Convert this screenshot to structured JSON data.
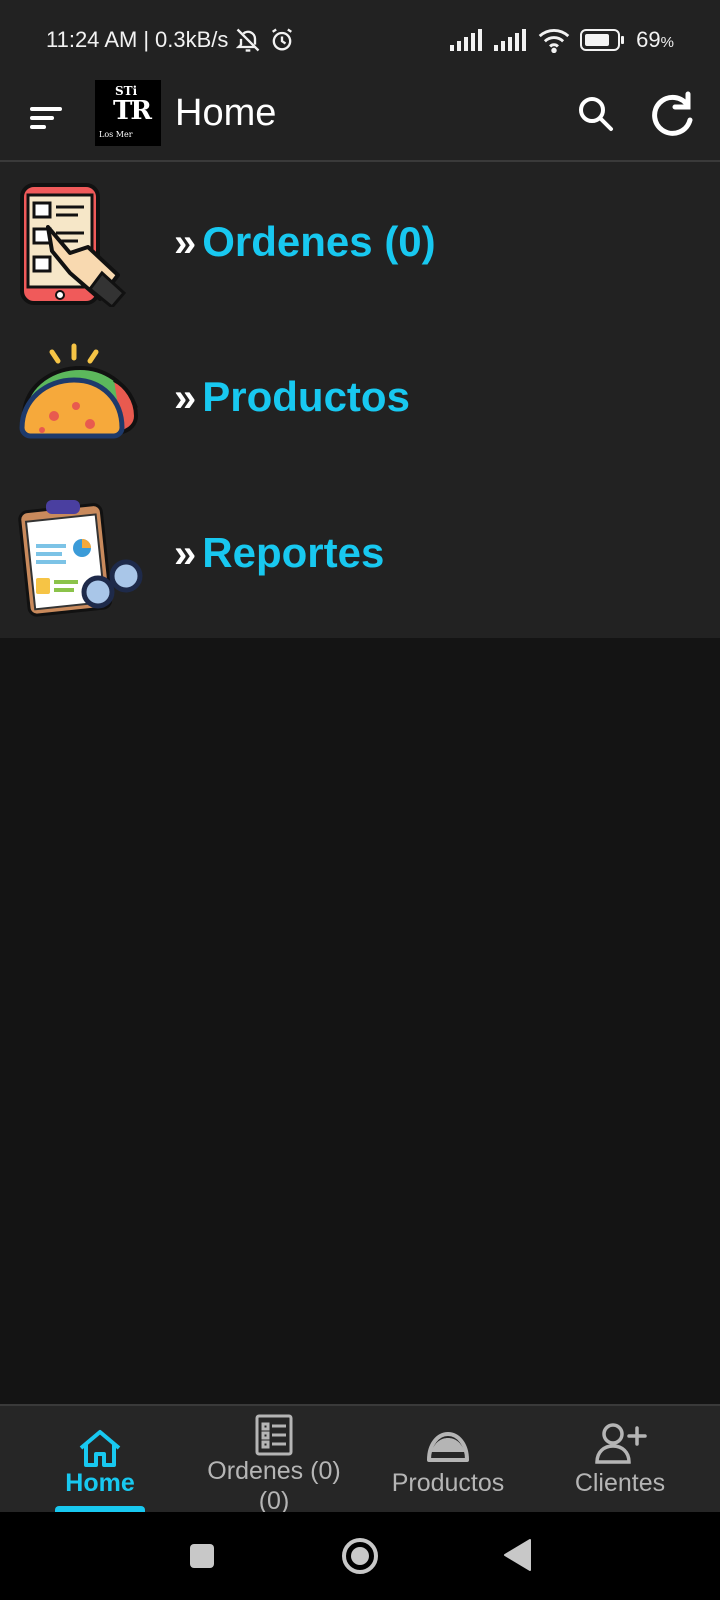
{
  "status_bar": {
    "time": "11:24 AM",
    "speed": "0.3kB/s",
    "battery_percent": "69",
    "battery_suffix": "%",
    "icons": [
      "bell-off-icon",
      "alarm-icon",
      "signal-icon",
      "signal-icon",
      "wifi-icon",
      "battery-icon"
    ]
  },
  "app_bar": {
    "title": "Home",
    "logo_text": {
      "line1": "STi",
      "line2": "TR",
      "line3": "Los Mer"
    },
    "icons": [
      "menu-icon",
      "search-icon",
      "refresh-icon"
    ]
  },
  "menu": {
    "items": [
      {
        "label": "Ordenes (0)",
        "icon": "order-tap-icon"
      },
      {
        "label": "Productos",
        "icon": "taco-icon"
      },
      {
        "label": "Reportes",
        "icon": "report-clipboard-icon"
      }
    ],
    "chevron": "»"
  },
  "bottom_nav": {
    "items": [
      {
        "label": "Home",
        "icon": "home-icon",
        "active": true
      },
      {
        "label": "Ordenes (0)\n(0)",
        "line1": "Ordenes (0)",
        "line2": "(0)",
        "icon": "list-icon",
        "active": false
      },
      {
        "label": "Productos",
        "icon": "taco-outline-icon",
        "active": false
      },
      {
        "label": "Clientes",
        "icon": "add-user-icon",
        "active": false
      }
    ]
  },
  "colors": {
    "accent": "#18c8f0",
    "background": "#141414",
    "surface": "#222222",
    "nav_background": "#262626",
    "inactive_text": "#b5b5b5"
  }
}
